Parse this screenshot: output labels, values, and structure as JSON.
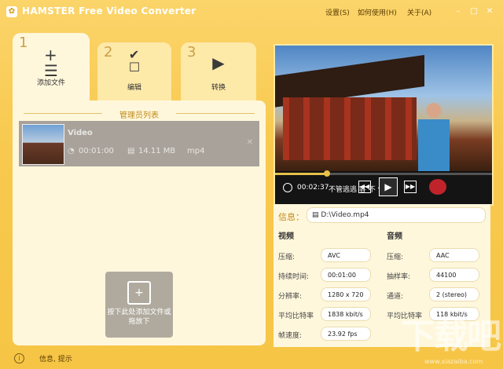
{
  "app": {
    "title": "HAMSTER Free Video Converter"
  },
  "menu": {
    "settings": "设置(S)",
    "howto": "如何使用(H)",
    "about": "关于(A)"
  },
  "tabs": [
    {
      "number": "1",
      "label": "添加文件"
    },
    {
      "number": "2",
      "label": "编辑"
    },
    {
      "number": "3",
      "label": "转换"
    }
  ],
  "list": {
    "header": "管理员列表",
    "item": {
      "name": "Video",
      "duration": "00:01:00",
      "size": "14.11 MB",
      "format": "mp4"
    },
    "drop_text": "按下此处添加文件或拖放下"
  },
  "player": {
    "time": "00:02:37",
    "subtitle": "不管逃逃 客 不 气",
    "progress": 0.24
  },
  "info": {
    "label": "信息：",
    "path": "D:\\Video.mp4",
    "video": {
      "header": "视频",
      "rows": [
        {
          "label": "压缩:",
          "value": "AVC"
        },
        {
          "label": "持续时间:",
          "value": "00:01:00"
        },
        {
          "label": "分辨率:",
          "value": "1280 x 720"
        },
        {
          "label": "平均比特率",
          "value": "1838 kbit/s"
        },
        {
          "label": "帧速度:",
          "value": "23.92 fps"
        }
      ]
    },
    "audio": {
      "header": "音频",
      "rows": [
        {
          "label": "压缩:",
          "value": "AAC"
        },
        {
          "label": "抽样率:",
          "value": "44100"
        },
        {
          "label": "通道:",
          "value": "2 (stereo)"
        },
        {
          "label": "平均比特率",
          "value": "118 kbit/s"
        }
      ]
    }
  },
  "status": {
    "text": "信息, 提示"
  },
  "watermark": {
    "big": "下载吧",
    "url": "www.xiazaiba.com"
  }
}
